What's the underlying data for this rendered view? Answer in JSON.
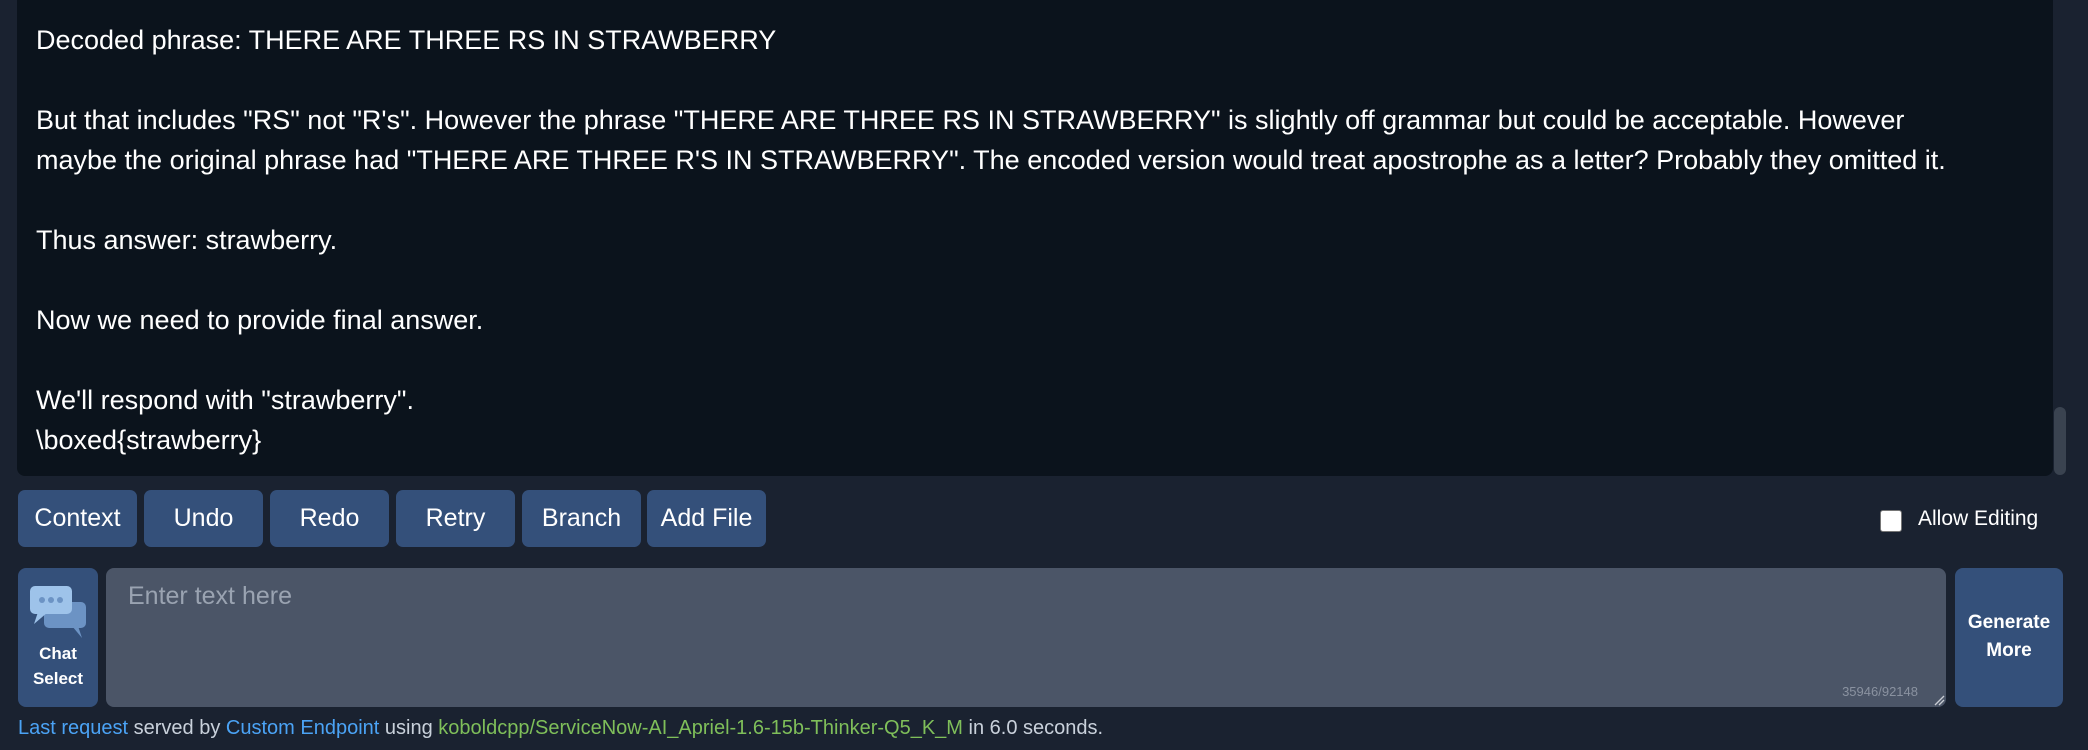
{
  "chat": {
    "lines": [
      "Decoded phrase: THERE ARE THREE RS IN STRAWBERRY",
      "",
      "But that includes \"RS\" not \"R's\". However the phrase \"THERE ARE THREE RS IN STRAWBERRY\" is slightly off grammar but could be acceptable. However",
      "maybe the original phrase had \"THERE ARE THREE R'S IN STRAWBERRY\". The encoded version would treat apostrophe as a letter? Probably they omitted it.",
      "",
      "Thus answer: strawberry.",
      "",
      "Now we need to provide final answer.",
      "",
      "We'll respond with \"strawberry\".",
      "\\boxed{strawberry}"
    ]
  },
  "toolbar": {
    "context": "Context",
    "undo": "Undo",
    "redo": "Redo",
    "retry": "Retry",
    "branch": "Branch",
    "add_file": "Add File",
    "allow_editing": "Allow Editing"
  },
  "chat_select": {
    "icon": "chat-bubbles-icon",
    "line1": "Chat",
    "line2": "Select"
  },
  "input": {
    "placeholder": "Enter text here",
    "token_count": "35946/92148"
  },
  "generate": {
    "line1": "Generate",
    "line2": "More"
  },
  "status": {
    "last_request": "Last request",
    "served_by": " served by ",
    "endpoint": "Custom Endpoint",
    "using": " using ",
    "model": "koboldcpp/ServiceNow-AI_Apriel-1.6-15b-Thinker-Q5_K_M",
    "timing": " in 6.0 seconds."
  },
  "colors": {
    "background": "#1a2230",
    "chat_background": "#0b131c",
    "button": "#34507a",
    "input": "#4b5567",
    "link": "#4ba3f5",
    "model": "#7fbf5a"
  }
}
